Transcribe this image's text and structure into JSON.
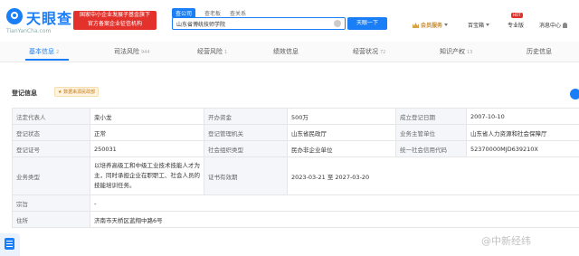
{
  "brand": {
    "name": "天眼查",
    "domain": "TianYanCha.com",
    "badge_line1": "国家中小企业发展子基金旗下",
    "badge_line2": "官方备案企业征信机构"
  },
  "search": {
    "tabs": [
      "查公司",
      "查老板",
      "查关系"
    ],
    "value": "山东省博统技师学院",
    "button": "天眼一下"
  },
  "nav": {
    "vip": "会员服务",
    "baike": "百宝箱",
    "hot": "HOT",
    "pro": "专业版",
    "messages": "消息中心"
  },
  "content_tabs": [
    {
      "label": "基本信息",
      "count": "2"
    },
    {
      "label": "司法风险",
      "count": "944"
    },
    {
      "label": "经营风险",
      "count": "1"
    },
    {
      "label": "绩效信息",
      "count": ""
    },
    {
      "label": "经营状况",
      "count": "72"
    },
    {
      "label": "知识产权",
      "count": "13"
    },
    {
      "label": "历史信息",
      "count": ""
    }
  ],
  "registration": {
    "title": "登记信息",
    "tag": "★ 数据来源民政部",
    "rows": {
      "legal_rep_label": "法定代表人",
      "legal_rep": "栾小龙",
      "capital_label": "开办资金",
      "capital": "500万",
      "founded_label": "成立登记日期",
      "founded": "2007-10-10",
      "status_label": "登记状态",
      "status": "正常",
      "authority_label": "登记管理机关",
      "authority": "山东省民政厅",
      "supervisor_label": "业务主管单位",
      "supervisor": "山东省人力资源和社会保障厅",
      "cert_label": "登记证号",
      "cert": "250031",
      "org_type_label": "社会组织类型",
      "org_type": "民办非企业单位",
      "credit_label": "统一社会信用代码",
      "credit": "52370000MJD639210X",
      "business_label": "业务类型",
      "business": "以培养高级工和中级工业技术技能人才为主，同时承担企业在职职工、社会人员的技能培训任务。",
      "validity_label": "证书有效期",
      "validity": "2023-03-21 至 2027-03-20",
      "purpose_label": "宗旨",
      "purpose": "-",
      "address_label": "住所",
      "address": "济南市天桥区蓝翔中路6号"
    }
  },
  "watermark": "@中新经纬"
}
